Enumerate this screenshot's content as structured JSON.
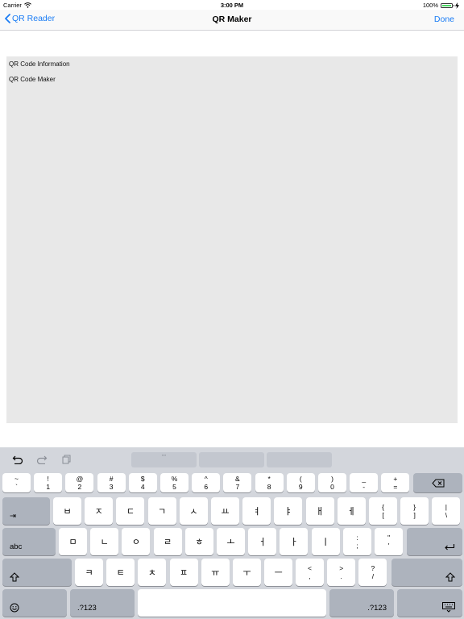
{
  "status_bar": {
    "carrier": "Carrier",
    "time": "3:00 PM",
    "battery": "100%",
    "battery_level": 1.0
  },
  "nav": {
    "back_label": "QR Reader",
    "title": "QR Maker",
    "done_label": "Done"
  },
  "panel": {
    "rows": [
      "QR Code Information",
      "QR Code Maker"
    ]
  },
  "keyboard": {
    "suggestion_center": "\"\"",
    "number_row": [
      {
        "top": "~",
        "bot": "`"
      },
      {
        "top": "!",
        "bot": "1"
      },
      {
        "top": "@",
        "bot": "2"
      },
      {
        "top": "#",
        "bot": "3"
      },
      {
        "top": "$",
        "bot": "4"
      },
      {
        "top": "%",
        "bot": "5"
      },
      {
        "top": "^",
        "bot": "6"
      },
      {
        "top": "&",
        "bot": "7"
      },
      {
        "top": "*",
        "bot": "8"
      },
      {
        "top": "(",
        "bot": "9"
      },
      {
        "top": ")",
        "bot": "0"
      },
      {
        "top": "_",
        "bot": "-"
      },
      {
        "top": "+",
        "bot": "="
      }
    ],
    "tab_label": "⇥",
    "row1": [
      "ㅂ",
      "ㅈ",
      "ㄷ",
      "ㄱ",
      "ㅅ",
      "ㅛ",
      "ㅕ",
      "ㅑ",
      "ㅐ",
      "ㅔ"
    ],
    "row1_extra": [
      {
        "top": "{",
        "bot": "["
      },
      {
        "top": "}",
        "bot": "]"
      },
      {
        "top": "|",
        "bot": "\\"
      }
    ],
    "abc_label": "abc",
    "row2": [
      "ㅁ",
      "ㄴ",
      "ㅇ",
      "ㄹ",
      "ㅎ",
      "ㅗ",
      "ㅓ",
      "ㅏ",
      "ㅣ"
    ],
    "row2_extra": [
      {
        "top": ":",
        "bot": ";"
      },
      {
        "top": "\"",
        "bot": "'"
      }
    ],
    "row3": [
      "ㅋ",
      "ㅌ",
      "ㅊ",
      "ㅍ",
      "ㅠ",
      "ㅜ",
      "ㅡ"
    ],
    "row3_extra": [
      {
        "top": "<",
        "bot": ","
      },
      {
        "top": ">",
        "bot": "."
      },
      {
        "top": "?",
        "bot": "/"
      }
    ],
    "num_label_left": ".?123",
    "num_label_right": ".?123"
  }
}
